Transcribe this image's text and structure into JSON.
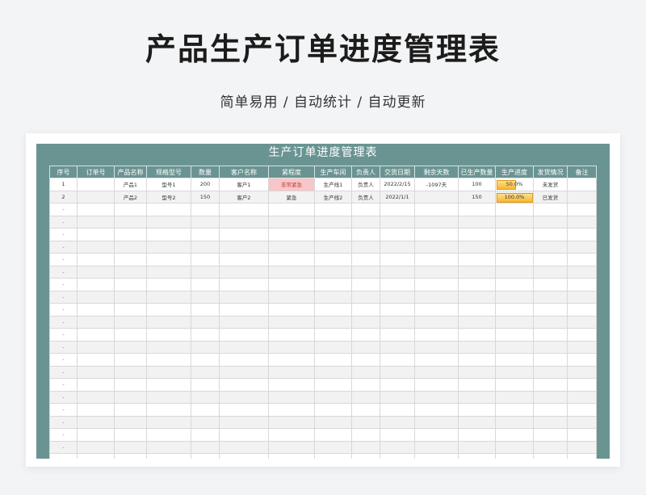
{
  "header": {
    "title": "产品生产订单进度管理表",
    "subtitle": "简单易用 / 自动统计 / 自动更新"
  },
  "sheet": {
    "title": "生产订单进度管理表",
    "columns": [
      "序号",
      "订单号",
      "产品名称",
      "规格型号",
      "数量",
      "客户名称",
      "紧程度",
      "生产车间",
      "负责人",
      "交货日期",
      "剩余天数",
      "已生产数量",
      "生产进度",
      "发货情况",
      "备注"
    ],
    "rows": [
      {
        "no": "1",
        "order": "",
        "product": "产品1",
        "spec": "型号1",
        "qty": "200",
        "customer": "客户1",
        "urgency": "非常紧急",
        "workshop": "生产线1",
        "owner": "负责人",
        "date": "2022/2/15",
        "remain": "-1097天",
        "produced": "100",
        "progress": "50.0%",
        "progress_value": 0.5,
        "ship": "未发货",
        "note": ""
      },
      {
        "no": "2",
        "order": "",
        "product": "产品2",
        "spec": "型号2",
        "qty": "150",
        "customer": "客户2",
        "urgency": "紧急",
        "workshop": "生产线2",
        "owner": "负责人",
        "date": "2022/1/1",
        "remain": "",
        "produced": "150",
        "progress": "100.0%",
        "progress_value": 1.0,
        "ship": "已发货",
        "note": ""
      }
    ],
    "empty_row_marker": "-",
    "empty_rows": 21
  },
  "colors": {
    "panel": "#6a9492",
    "urgent_very": "#f7c6c8",
    "progress_bar": "#f7b733"
  }
}
